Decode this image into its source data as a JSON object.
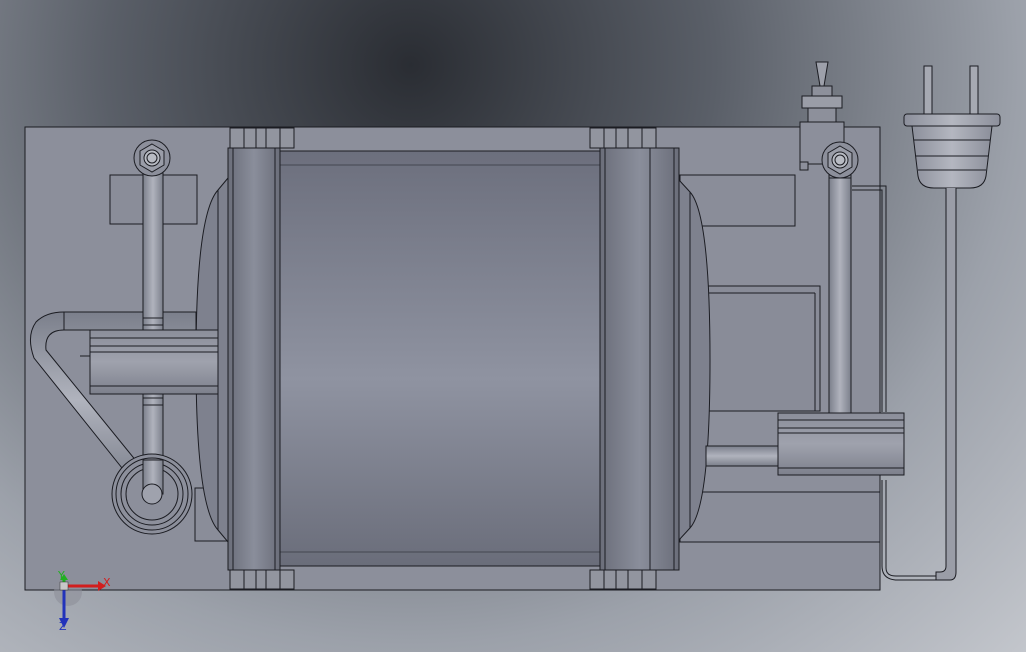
{
  "viewport": {
    "background_dark": "#2a2d33",
    "background_light": "#c3c6cc",
    "part_fill": "#8c8f9b",
    "line_color": "#1b1c22"
  },
  "axis_triad": {
    "x_label": "X",
    "y_label": "Y",
    "z_label": "Z",
    "x_color": "#d21e1e",
    "y_color": "#20b020",
    "z_color": "#2233bb"
  },
  "parts": [
    "base-plate",
    "motor-body",
    "left-flange",
    "right-flange",
    "left-pump",
    "right-pump",
    "left-pipe",
    "right-pipe",
    "toggle-switch",
    "power-plug",
    "power-cord"
  ]
}
